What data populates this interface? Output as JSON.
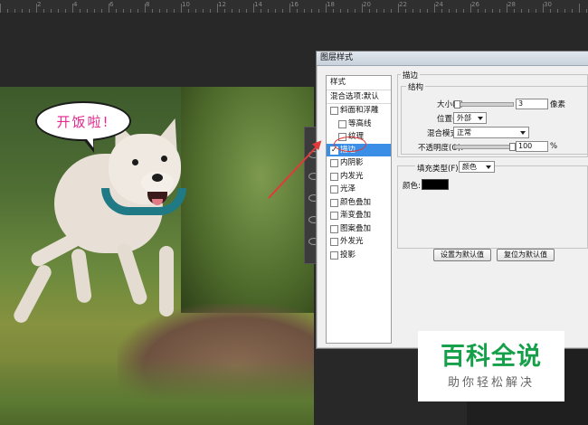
{
  "ruler": {
    "labels": [
      "2",
      "4",
      "6",
      "8",
      "10",
      "12",
      "14",
      "16",
      "18",
      "20",
      "22",
      "24",
      "26",
      "28",
      "30"
    ]
  },
  "photo": {
    "bubble_text": "开饭啦!"
  },
  "dialog": {
    "title": "图层样式",
    "list": [
      {
        "label": "样式",
        "type": "head"
      },
      {
        "label": "混合选项:默认",
        "type": "head"
      },
      {
        "label": "斜面和浮雕",
        "type": "ind1",
        "checked": false
      },
      {
        "label": "等高线",
        "type": "ind2",
        "checked": false
      },
      {
        "label": "纹理",
        "type": "ind2",
        "checked": false
      },
      {
        "label": "描边",
        "type": "ind1",
        "checked": true,
        "selected": true
      },
      {
        "label": "内阴影",
        "type": "ind1",
        "checked": false
      },
      {
        "label": "内发光",
        "type": "ind1",
        "checked": false
      },
      {
        "label": "光泽",
        "type": "ind1",
        "checked": false
      },
      {
        "label": "颜色叠加",
        "type": "ind1",
        "checked": false
      },
      {
        "label": "渐变叠加",
        "type": "ind1",
        "checked": false
      },
      {
        "label": "图案叠加",
        "type": "ind1",
        "checked": false
      },
      {
        "label": "外发光",
        "type": "ind1",
        "checked": false
      },
      {
        "label": "投影",
        "type": "ind1",
        "checked": false
      }
    ],
    "stroke": {
      "section_title": "描边",
      "structure_title": "结构",
      "size_label": "大小(S):",
      "size_value": "3",
      "size_unit": "像素",
      "position_label": "位置(P):",
      "position_value": "外部",
      "blend_label": "混合模式(B):",
      "blend_value": "正常",
      "opacity_label": "不透明度(O):",
      "opacity_value": "100",
      "opacity_unit": "%",
      "fill_type_label": "填充类型(F):",
      "fill_type_value": "颜色",
      "color_label": "颜色:",
      "color_value": "#000000"
    },
    "buttons": {
      "set_default": "设置为默认值",
      "reset_default": "复位为默认值"
    }
  },
  "watermark": {
    "main": "百科全说",
    "sub": "助你轻松解决",
    "color": "#17a04a"
  }
}
